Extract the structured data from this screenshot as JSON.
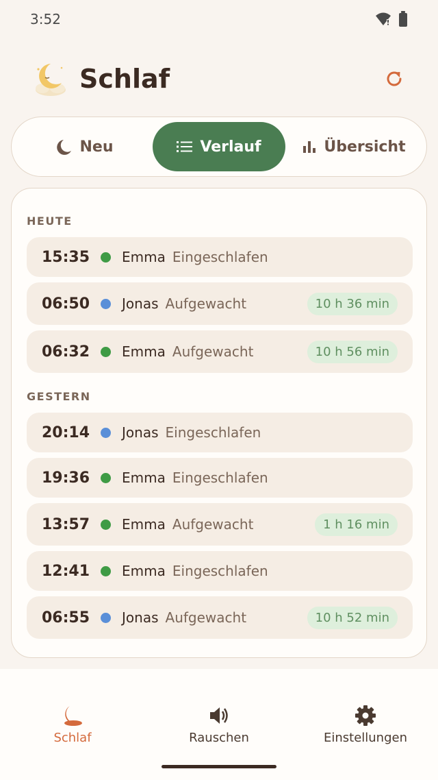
{
  "status_bar": {
    "time": "3:52"
  },
  "header": {
    "title": "Schlaf"
  },
  "tabs": [
    {
      "label": "Neu"
    },
    {
      "label": "Verlauf"
    },
    {
      "label": "Übersicht"
    }
  ],
  "history": {
    "sections": [
      {
        "label": "HEUTE",
        "entries": [
          {
            "time": "15:35",
            "child": "Emma",
            "event": "Eingeschlafen",
            "duration": ""
          },
          {
            "time": "06:50",
            "child": "Jonas",
            "event": "Aufgewacht",
            "duration": "10 h 36 min"
          },
          {
            "time": "06:32",
            "child": "Emma",
            "event": "Aufgewacht",
            "duration": "10 h 56 min"
          }
        ]
      },
      {
        "label": "GESTERN",
        "entries": [
          {
            "time": "20:14",
            "child": "Jonas",
            "event": "Eingeschlafen",
            "duration": ""
          },
          {
            "time": "19:36",
            "child": "Emma",
            "event": "Eingeschlafen",
            "duration": ""
          },
          {
            "time": "13:57",
            "child": "Emma",
            "event": "Aufgewacht",
            "duration": "1 h 16 min"
          },
          {
            "time": "12:41",
            "child": "Emma",
            "event": "Eingeschlafen",
            "duration": ""
          },
          {
            "time": "06:55",
            "child": "Jonas",
            "event": "Aufgewacht",
            "duration": "10 h 52 min"
          }
        ]
      }
    ]
  },
  "bottom_nav": [
    {
      "label": "Schlaf",
      "icon": "moon-icon"
    },
    {
      "label": "Rauschen",
      "icon": "speaker-icon"
    },
    {
      "label": "Einstellungen",
      "icon": "gear-icon"
    }
  ],
  "colors": {
    "accent": "#d46a3c",
    "active_tab": "#4a7d52",
    "emma_dot": "#3f9b45",
    "jonas_dot": "#5a8fd8",
    "badge_bg": "#deefdc"
  }
}
